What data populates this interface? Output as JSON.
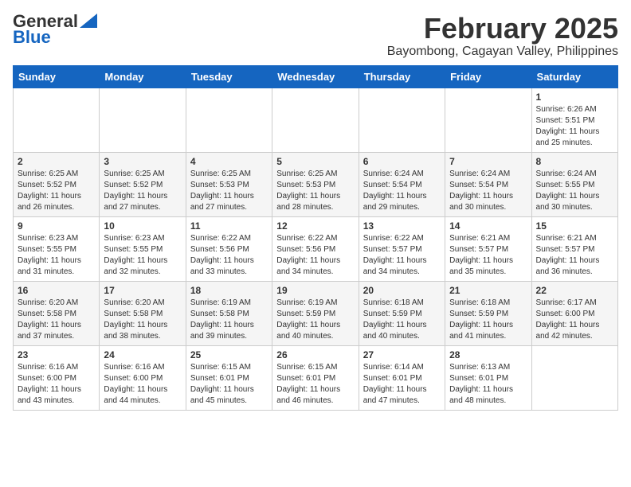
{
  "header": {
    "logo_general": "General",
    "logo_blue": "Blue",
    "month_title": "February 2025",
    "subtitle": "Bayombong, Cagayan Valley, Philippines"
  },
  "weekdays": [
    "Sunday",
    "Monday",
    "Tuesday",
    "Wednesday",
    "Thursday",
    "Friday",
    "Saturday"
  ],
  "weeks": [
    [
      {
        "day": "",
        "info": ""
      },
      {
        "day": "",
        "info": ""
      },
      {
        "day": "",
        "info": ""
      },
      {
        "day": "",
        "info": ""
      },
      {
        "day": "",
        "info": ""
      },
      {
        "day": "",
        "info": ""
      },
      {
        "day": "1",
        "info": "Sunrise: 6:26 AM\nSunset: 5:51 PM\nDaylight: 11 hours\nand 25 minutes."
      }
    ],
    [
      {
        "day": "2",
        "info": "Sunrise: 6:25 AM\nSunset: 5:52 PM\nDaylight: 11 hours\nand 26 minutes."
      },
      {
        "day": "3",
        "info": "Sunrise: 6:25 AM\nSunset: 5:52 PM\nDaylight: 11 hours\nand 27 minutes."
      },
      {
        "day": "4",
        "info": "Sunrise: 6:25 AM\nSunset: 5:53 PM\nDaylight: 11 hours\nand 27 minutes."
      },
      {
        "day": "5",
        "info": "Sunrise: 6:25 AM\nSunset: 5:53 PM\nDaylight: 11 hours\nand 28 minutes."
      },
      {
        "day": "6",
        "info": "Sunrise: 6:24 AM\nSunset: 5:54 PM\nDaylight: 11 hours\nand 29 minutes."
      },
      {
        "day": "7",
        "info": "Sunrise: 6:24 AM\nSunset: 5:54 PM\nDaylight: 11 hours\nand 30 minutes."
      },
      {
        "day": "8",
        "info": "Sunrise: 6:24 AM\nSunset: 5:55 PM\nDaylight: 11 hours\nand 30 minutes."
      }
    ],
    [
      {
        "day": "9",
        "info": "Sunrise: 6:23 AM\nSunset: 5:55 PM\nDaylight: 11 hours\nand 31 minutes."
      },
      {
        "day": "10",
        "info": "Sunrise: 6:23 AM\nSunset: 5:55 PM\nDaylight: 11 hours\nand 32 minutes."
      },
      {
        "day": "11",
        "info": "Sunrise: 6:22 AM\nSunset: 5:56 PM\nDaylight: 11 hours\nand 33 minutes."
      },
      {
        "day": "12",
        "info": "Sunrise: 6:22 AM\nSunset: 5:56 PM\nDaylight: 11 hours\nand 34 minutes."
      },
      {
        "day": "13",
        "info": "Sunrise: 6:22 AM\nSunset: 5:57 PM\nDaylight: 11 hours\nand 34 minutes."
      },
      {
        "day": "14",
        "info": "Sunrise: 6:21 AM\nSunset: 5:57 PM\nDaylight: 11 hours\nand 35 minutes."
      },
      {
        "day": "15",
        "info": "Sunrise: 6:21 AM\nSunset: 5:57 PM\nDaylight: 11 hours\nand 36 minutes."
      }
    ],
    [
      {
        "day": "16",
        "info": "Sunrise: 6:20 AM\nSunset: 5:58 PM\nDaylight: 11 hours\nand 37 minutes."
      },
      {
        "day": "17",
        "info": "Sunrise: 6:20 AM\nSunset: 5:58 PM\nDaylight: 11 hours\nand 38 minutes."
      },
      {
        "day": "18",
        "info": "Sunrise: 6:19 AM\nSunset: 5:58 PM\nDaylight: 11 hours\nand 39 minutes."
      },
      {
        "day": "19",
        "info": "Sunrise: 6:19 AM\nSunset: 5:59 PM\nDaylight: 11 hours\nand 40 minutes."
      },
      {
        "day": "20",
        "info": "Sunrise: 6:18 AM\nSunset: 5:59 PM\nDaylight: 11 hours\nand 40 minutes."
      },
      {
        "day": "21",
        "info": "Sunrise: 6:18 AM\nSunset: 5:59 PM\nDaylight: 11 hours\nand 41 minutes."
      },
      {
        "day": "22",
        "info": "Sunrise: 6:17 AM\nSunset: 6:00 PM\nDaylight: 11 hours\nand 42 minutes."
      }
    ],
    [
      {
        "day": "23",
        "info": "Sunrise: 6:16 AM\nSunset: 6:00 PM\nDaylight: 11 hours\nand 43 minutes."
      },
      {
        "day": "24",
        "info": "Sunrise: 6:16 AM\nSunset: 6:00 PM\nDaylight: 11 hours\nand 44 minutes."
      },
      {
        "day": "25",
        "info": "Sunrise: 6:15 AM\nSunset: 6:01 PM\nDaylight: 11 hours\nand 45 minutes."
      },
      {
        "day": "26",
        "info": "Sunrise: 6:15 AM\nSunset: 6:01 PM\nDaylight: 11 hours\nand 46 minutes."
      },
      {
        "day": "27",
        "info": "Sunrise: 6:14 AM\nSunset: 6:01 PM\nDaylight: 11 hours\nand 47 minutes."
      },
      {
        "day": "28",
        "info": "Sunrise: 6:13 AM\nSunset: 6:01 PM\nDaylight: 11 hours\nand 48 minutes."
      },
      {
        "day": "",
        "info": ""
      }
    ]
  ]
}
